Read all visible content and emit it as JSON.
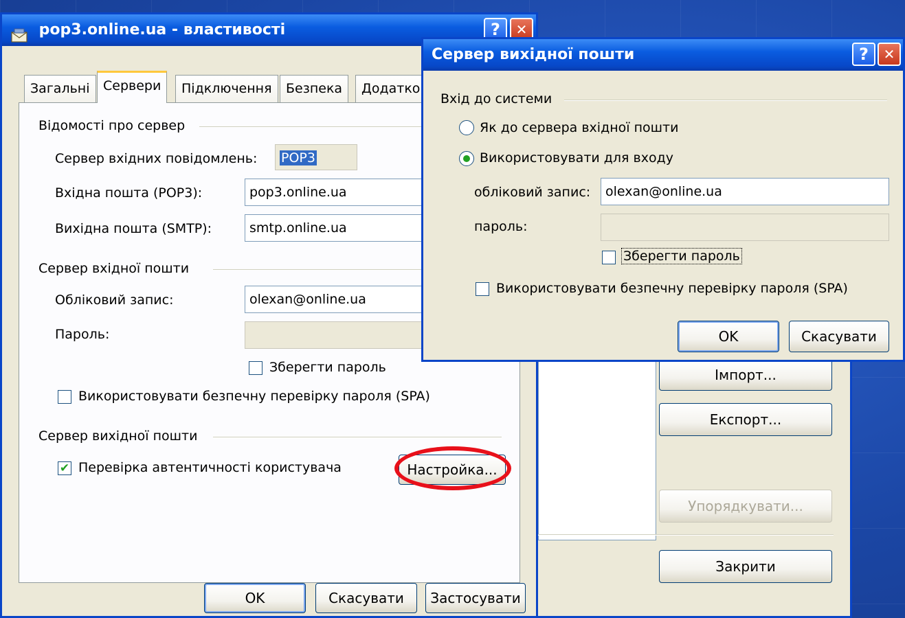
{
  "main_window": {
    "title": "pop3.online.ua - властивості",
    "help_glyph": "?",
    "close_glyph": "✕",
    "tabs": [
      "Загальні",
      "Сервери",
      "Підключення",
      "Безпека",
      "Додатко"
    ],
    "active_tab": "Сервери",
    "server_info_group": "Відомості про сервер",
    "incoming_server_label": "Сервер вхідних повідомлень:",
    "incoming_server_value": "POP3",
    "incoming_mail_label": "Вхідна пошта (POP3):",
    "incoming_mail_value": "pop3.online.ua",
    "outgoing_mail_label": "Вихідна пошта (SMTP):",
    "outgoing_mail_value": "smtp.online.ua",
    "incoming_group": "Сервер вхідної пошти",
    "account_label": "Обліковий запис:",
    "account_value": "olexan@online.ua",
    "password_label": "Пароль:",
    "password_value": "",
    "remember_password": "Зберегти пароль",
    "spa_label": "Використовувати безпечну перевірку пароля (SPA)",
    "outgoing_group": "Сервер вихідної пошти",
    "auth_label": "Перевірка автентичності користувача",
    "auth_checked": true,
    "settings_button": "Настройка...",
    "ok_button": "OK",
    "cancel_button": "Скасувати",
    "apply_button": "Застосувати"
  },
  "accounts_window": {
    "import_button": "Імпорт...",
    "export_button": "Експорт...",
    "order_button": "Упорядкувати...",
    "close_button": "Закрити"
  },
  "outgoing_dialog": {
    "title": "Сервер вихідної пошти",
    "help_glyph": "?",
    "close_glyph": "✕",
    "login_group": "Вхід до системи",
    "radio_same": "Як до сервера вхідної пошти",
    "radio_use": "Використовувати для входу",
    "selected_radio": "radio_use",
    "account_label": "обліковий запис:",
    "account_value": "olexan@online.ua",
    "password_label": "пароль:",
    "password_value": "",
    "remember_password": "Зберегти пароль",
    "spa_label": "Використовувати безпечну перевірку пароля (SPA)",
    "ok_button": "OK",
    "cancel_button": "Скасувати"
  },
  "colors": {
    "titlebar": "#0a5ce0",
    "highlight_ring": "#e8101a",
    "window_face": "#ece9d8"
  },
  "icons": {
    "window_icon": "envelope-icon",
    "check_mark": "✔"
  }
}
